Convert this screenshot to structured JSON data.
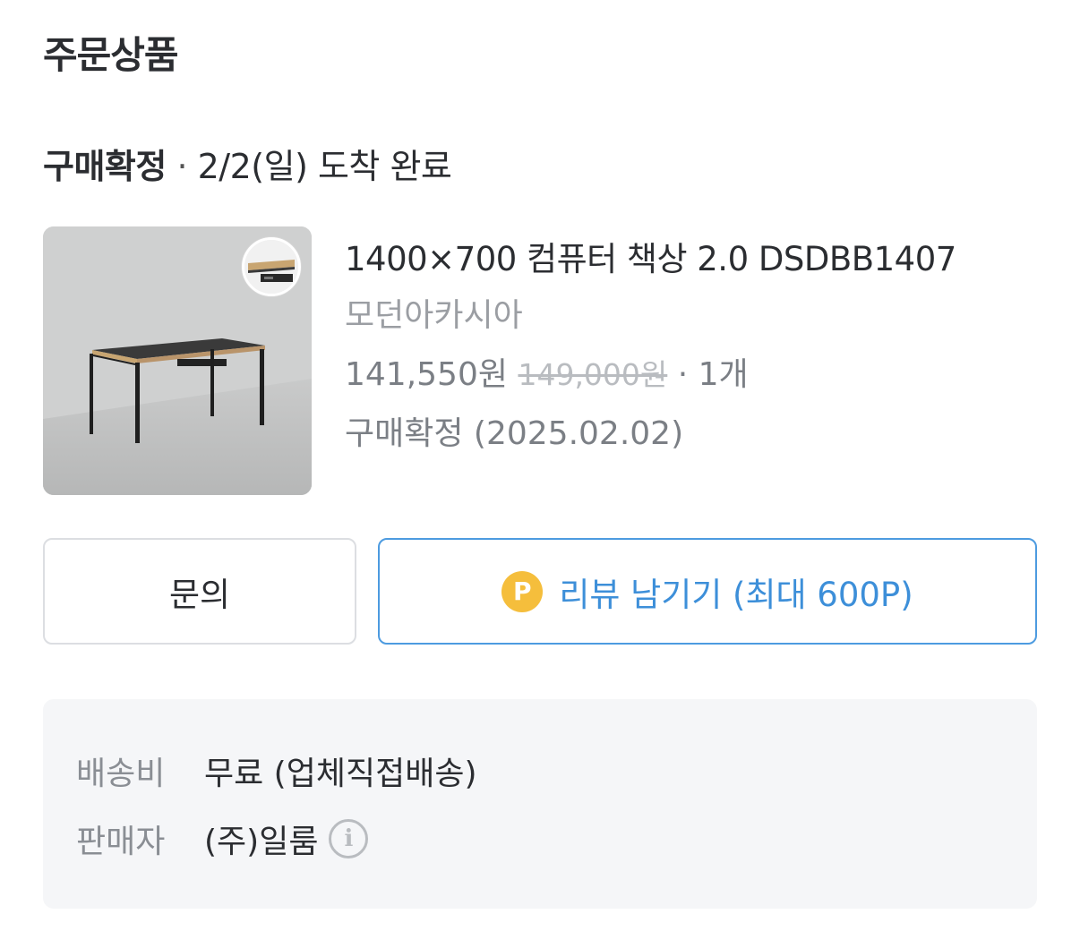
{
  "section_title": "주문상품",
  "status": {
    "label": "구매확정",
    "separator": "·",
    "detail": "2/2(일) 도착 완료"
  },
  "product": {
    "name": "1400×700 컴퓨터 책상 2.0 DSDBB1407",
    "seller": "모던아카시아",
    "price": "141,550원",
    "original_price": "149,000원",
    "quantity": "· 1개",
    "confirmation": "구매확정 (2025.02.02)"
  },
  "actions": {
    "inquiry_label": "문의",
    "review_badge": "P",
    "review_label": "리뷰 남기기 (최대 600P)"
  },
  "details": {
    "shipping_label": "배송비",
    "shipping_value": "무료 (업체직접배송)",
    "seller_label": "판매자",
    "seller_value": "(주)일룸",
    "info_icon": "i"
  },
  "colors": {
    "accent_blue": "#4d9be0",
    "point_badge": "#f5be3c",
    "muted_text": "#9b9ea3",
    "panel_bg": "#f5f6f8"
  }
}
